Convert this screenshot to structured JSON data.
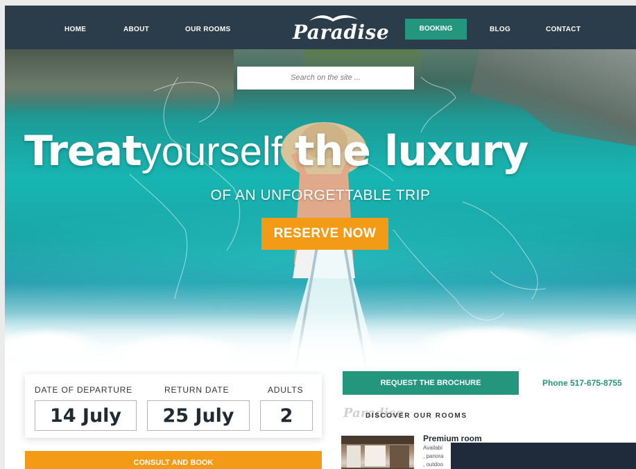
{
  "nav": {
    "items": [
      "HOME",
      "ABOUT",
      "OUR ROOMS",
      "BOOKING",
      "BLOG",
      "CONTACT"
    ],
    "logo": "Paradise",
    "active": "BOOKING"
  },
  "hero": {
    "search_placeholder": "Search on the site ...",
    "headline": {
      "part1": "Treat",
      "part2": "yourself",
      "part3": "the luxury"
    },
    "subheadline": "OF AN UNFORGETTABLE TRIP",
    "cta": "RESERVE NOW"
  },
  "booking": {
    "departure": {
      "label": "DATE OF DEPARTURE",
      "value": "14 July"
    },
    "return": {
      "label": "RETURN DATE",
      "value": "25 July"
    },
    "adults": {
      "label": "ADULTS",
      "value": "2"
    },
    "submit": "CONSULT AND BOOK"
  },
  "sidebar": {
    "brochure_button": "REQUEST THE BROCHURE",
    "phone": "Phone 517-675-8755",
    "discover_logo": "Paradise",
    "discover_title": "DISCOVER OUR ROOMS",
    "room": {
      "title": "Premium room",
      "lines": [
        "Availabi",
        ", panora",
        ", outdoo"
      ]
    }
  },
  "colors": {
    "nav_bg": "#2b3d4a",
    "accent_green": "#23967d",
    "accent_orange": "#f39a17"
  }
}
